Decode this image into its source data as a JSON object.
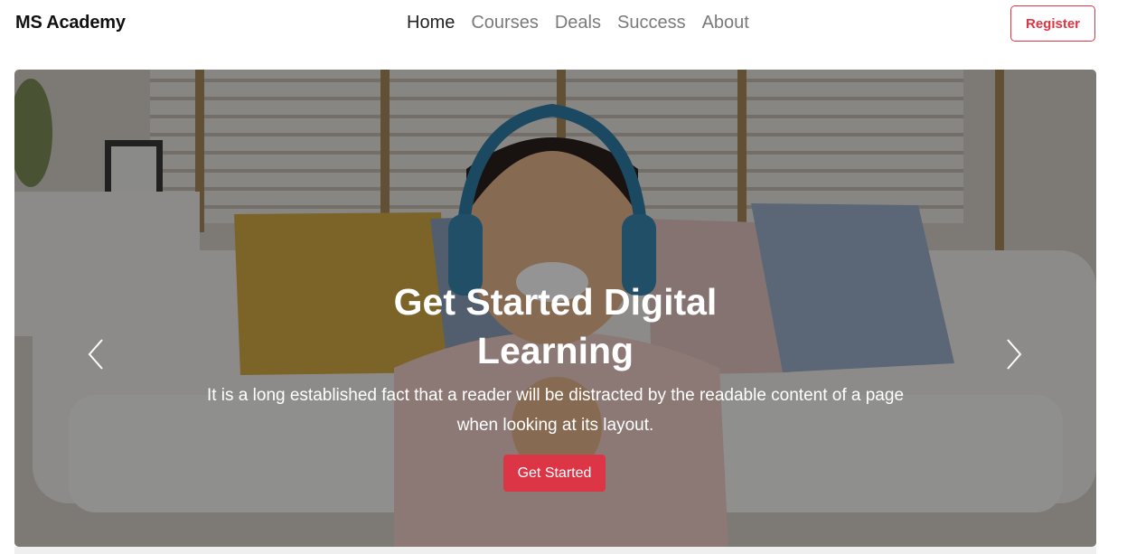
{
  "navbar": {
    "brand": "MS Academy",
    "links": [
      {
        "label": "Home",
        "active": true
      },
      {
        "label": "Courses",
        "active": false
      },
      {
        "label": "Deals",
        "active": false
      },
      {
        "label": "Success",
        "active": false
      },
      {
        "label": "About",
        "active": false
      }
    ],
    "register_label": "Register"
  },
  "hero": {
    "title": "Get Started Digital Learning",
    "text": "It is a long established fact that a reader will be distracted by the readable content of a page when looking at its layout.",
    "cta_label": "Get Started",
    "prev_icon": "chevron-left-icon",
    "next_icon": "chevron-right-icon"
  },
  "colors": {
    "accent": "#dc3545",
    "nav_inactive": "#7a7a7a",
    "nav_active": "#222222"
  }
}
